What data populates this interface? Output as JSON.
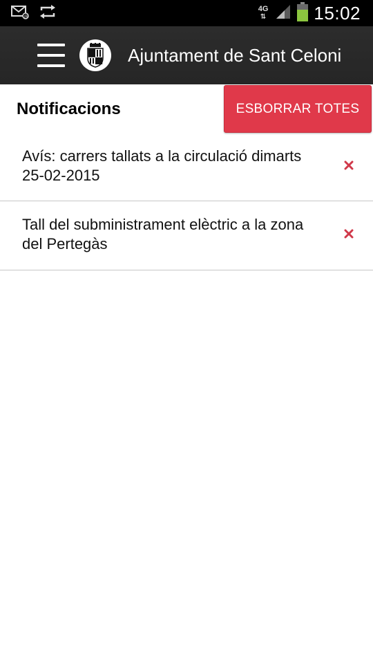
{
  "status_bar": {
    "time": "15:02",
    "network": "4G",
    "network_arrows": "⇅",
    "icons": [
      "mail-icon",
      "sync-icon",
      "signal-icon",
      "battery-icon"
    ]
  },
  "app_bar": {
    "title": "Ajuntament de Sant Celoni",
    "menu_icon": "hamburger-menu-icon",
    "logo_icon": "coat-of-arms-logo"
  },
  "notifications": {
    "title": "Notificacions",
    "clear_all_label": "ESBORRAR TOTES",
    "items": [
      {
        "text": "Avís: carrers tallats a la circulació dimarts 25-02-2015"
      },
      {
        "text": "Tall del subministrament elèctric a la zona del Pertegàs"
      }
    ]
  },
  "colors": {
    "status_bar_bg": "#000000",
    "app_bar_bg": "#2a2a2a",
    "accent_red": "#e0394a",
    "delete_icon": "#d0394a"
  }
}
